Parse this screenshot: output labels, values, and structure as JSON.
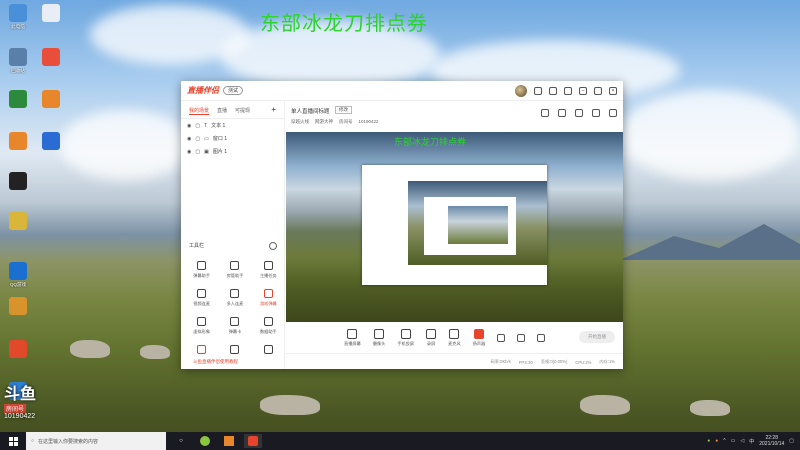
{
  "banner_text": "东部冰龙刀排点券",
  "desktop_icons": [
    {
      "label": "此电脑",
      "icon": "computer-icon",
      "color": "#4a90d9"
    },
    {
      "label": "",
      "icon": "document-icon",
      "color": "#e9eef6"
    },
    {
      "label": "回收站",
      "icon": "recycle-bin-icon",
      "color": "#5a7fa8"
    },
    {
      "label": "",
      "icon": "pinwheel-app-icon",
      "color": "#e94e3a"
    },
    {
      "label": "",
      "icon": "lion-app-icon",
      "color": "#2c8a3d"
    },
    {
      "label": "",
      "icon": "fox-app-icon",
      "color": "#e8862c"
    },
    {
      "label": "",
      "icon": "fox-app-icon-2",
      "color": "#e8862c"
    },
    {
      "label": "",
      "icon": "blue-app-icon",
      "color": "#2a6bd4"
    },
    {
      "label": "",
      "icon": "penguin-qq-icon",
      "color": "#222"
    },
    {
      "label": "",
      "icon": "file-icon",
      "color": "#d9b53a"
    },
    {
      "label": "QQ游戏",
      "icon": "qq-game-icon",
      "color": "#1b6fd1"
    },
    {
      "label": "",
      "icon": "game-icon",
      "color": "#d9932c"
    },
    {
      "label": "",
      "icon": "windows-tiles-icon",
      "color": "#e04a2a"
    },
    {
      "label": "",
      "icon": "globe-icon",
      "color": "#2f7fd4"
    }
  ],
  "app": {
    "logo": "直播伴侣",
    "beta": "测试",
    "tabs": [
      "我的场景",
      "直播",
      "可提现"
    ],
    "scenes": [
      "文本 1",
      "窗口 1",
      "图片 1"
    ],
    "tools_title": "工具栏",
    "tools": [
      {
        "label": "弹幕助手",
        "icon": "danmaku-icon",
        "red": false
      },
      {
        "label": "房管助手",
        "icon": "user-icon",
        "red": false
      },
      {
        "label": "主播任务",
        "icon": "task-icon",
        "red": false
      },
      {
        "label": "视频连麦",
        "icon": "video-link-icon",
        "red": false
      },
      {
        "label": "多人连麦",
        "icon": "download-icon",
        "red": false
      },
      {
        "label": "游戏弹幕",
        "icon": "game-danmaku-icon",
        "red": true
      },
      {
        "label": "虚拟形象",
        "icon": "avatar-icon",
        "red": false
      },
      {
        "label": "弹幕卡",
        "icon": "download-icon-2",
        "red": false
      },
      {
        "label": "数据助手",
        "icon": "data-icon",
        "red": false
      },
      {
        "label": "",
        "icon": "megaphone-icon",
        "red": true
      },
      {
        "label": "",
        "icon": "pin-icon",
        "red": false
      },
      {
        "label": "",
        "icon": "chevron-up-icon",
        "red": false
      }
    ],
    "tip": "斗鱼直播伴侣使用教程",
    "room_name": "单人直播间标题",
    "modify": "修改",
    "room_sub": [
      "穿越火线",
      "网游大神",
      "房间号",
      "10190422"
    ],
    "bottom_tools": [
      {
        "label": "直播屏幕",
        "icon": "screen-icon"
      },
      {
        "label": "摄像头",
        "icon": "camera-icon"
      },
      {
        "label": "手机投屏",
        "icon": "phone-cast-icon"
      },
      {
        "label": "录屏",
        "icon": "record-icon"
      },
      {
        "label": "麦克风",
        "icon": "mic-icon"
      },
      {
        "label": "扬声器",
        "icon": "speaker-icon",
        "red": true
      }
    ],
    "start_live": "开始直播",
    "status": [
      "码率:0Kb/s",
      "FPS:30",
      "丢帧:0(0.00%)",
      "CPU:2%",
      "内存:1%"
    ]
  },
  "watermark": {
    "logo": "斗鱼",
    "sub": "房间号",
    "id": "10190422"
  },
  "taskbar": {
    "search_placeholder": "在这里输入你要搜索的内容",
    "time": "22:28",
    "date": "2021/10/14",
    "apps": [
      "task-view-icon",
      "app1-icon",
      "app2-icon",
      "app3-icon"
    ]
  }
}
